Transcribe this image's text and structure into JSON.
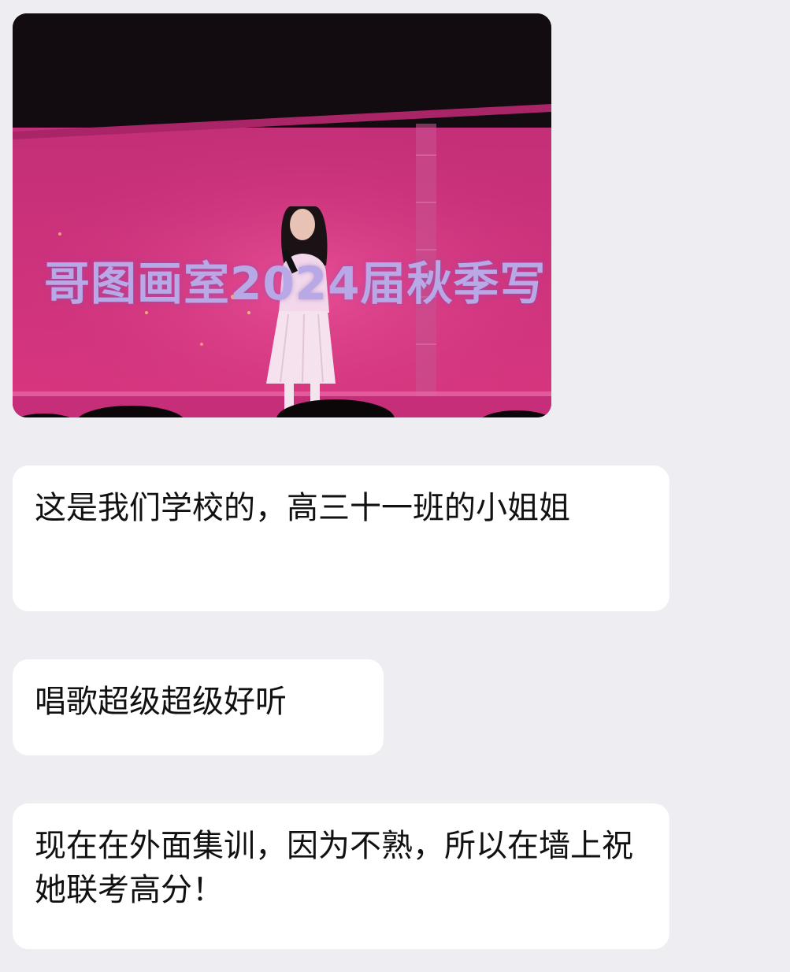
{
  "photo": {
    "banner_text": "哥图画室2024届秋季写"
  },
  "messages": [
    {
      "text": "这是我们学校的，高三十一班的小姐姐"
    },
    {
      "text": "唱歌超级超级好听"
    },
    {
      "text": "现在在外面集训，因为不熟，所以在墙上祝她联考高分！"
    }
  ]
}
